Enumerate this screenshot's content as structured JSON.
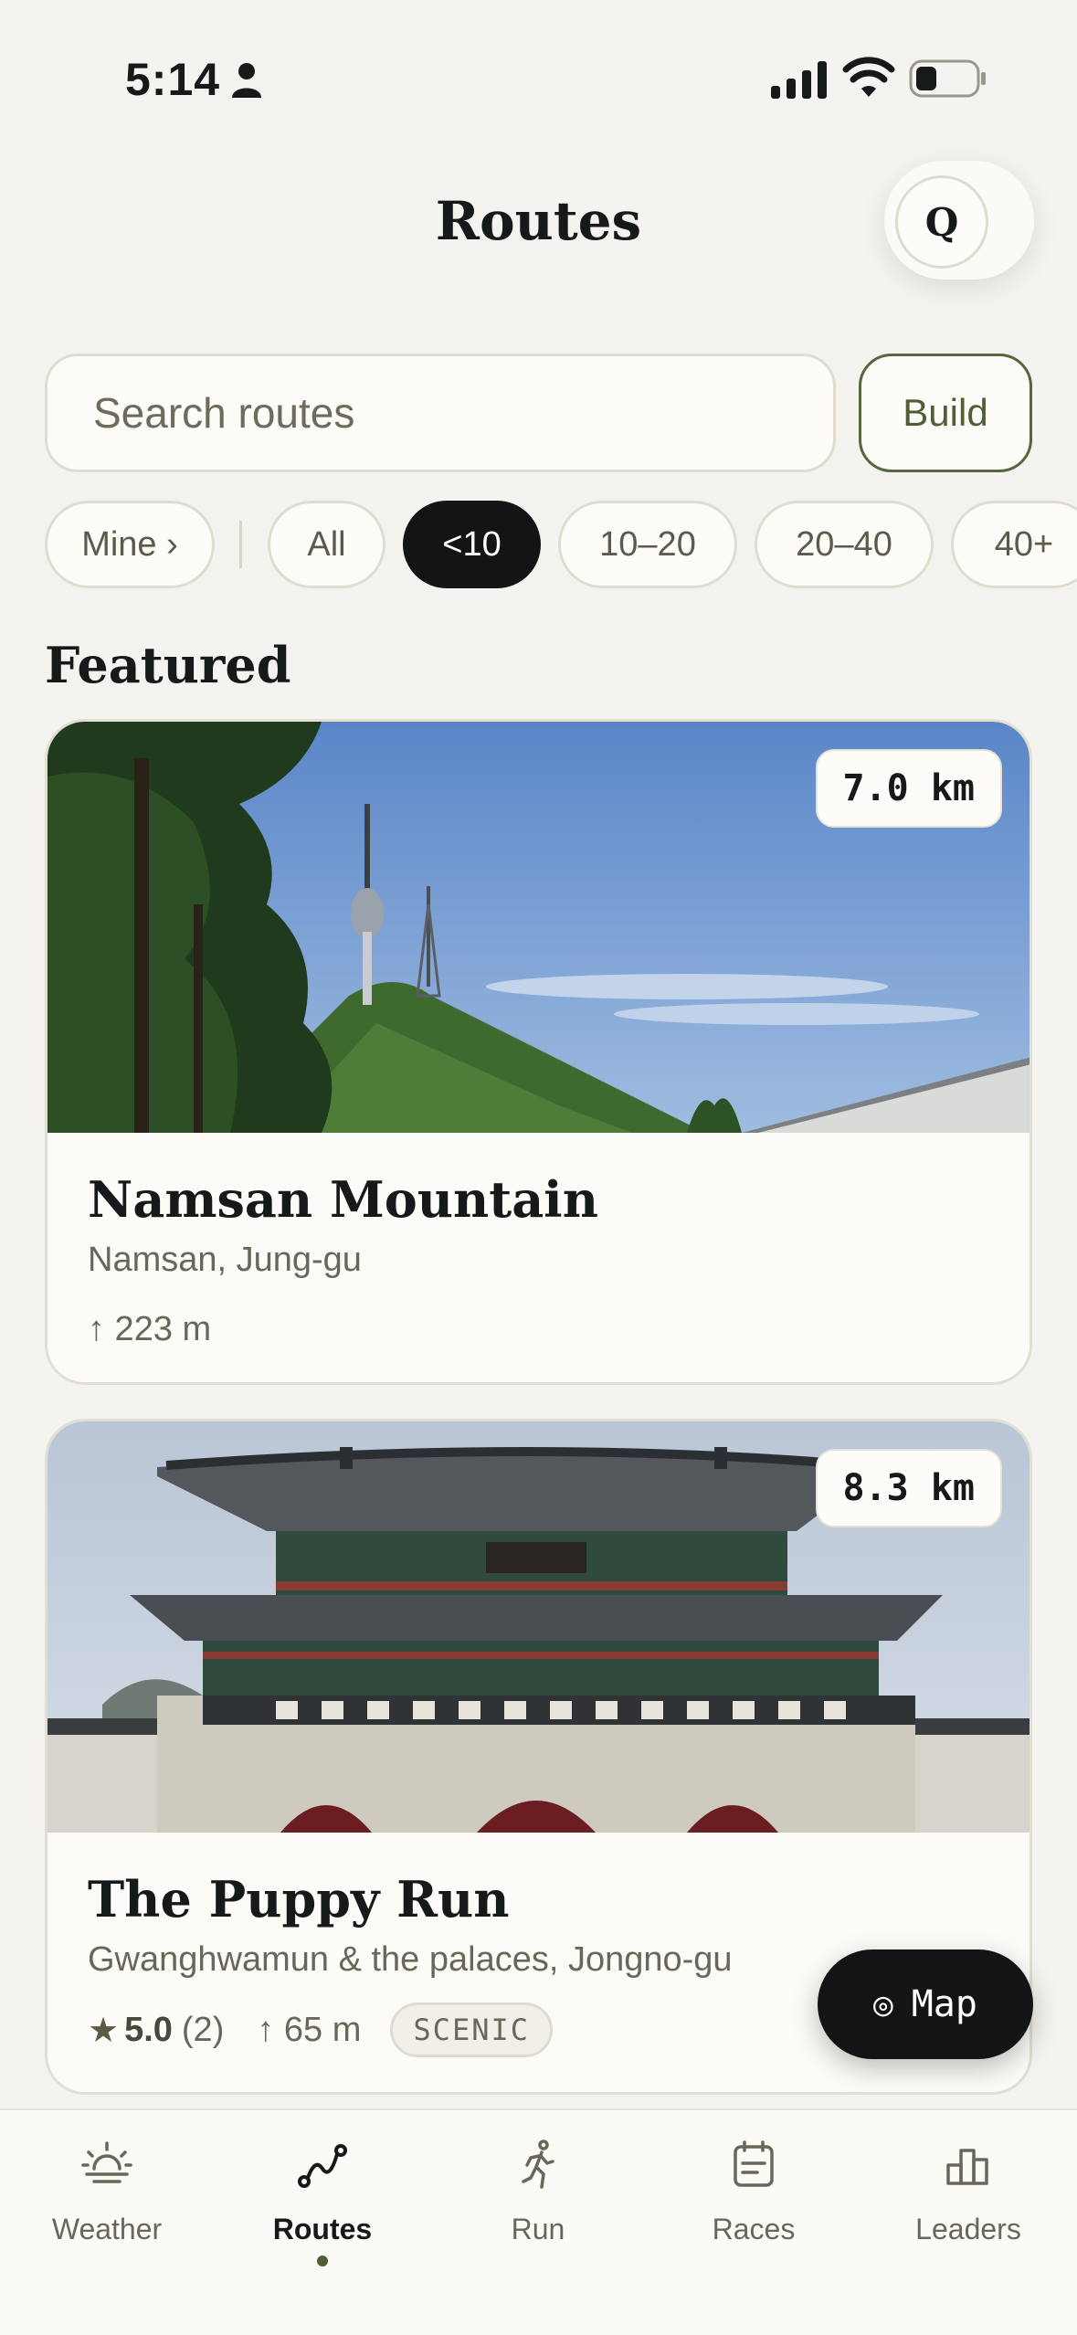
{
  "status": {
    "time": "5:14"
  },
  "header": {
    "title": "Routes",
    "avatar_initial": "Q"
  },
  "search": {
    "placeholder": "Search routes",
    "build_label": "Build"
  },
  "filters": {
    "mine": "Mine ›",
    "chips": [
      "All",
      "<10",
      "10–20",
      "20–40",
      "40+"
    ],
    "active": "<10"
  },
  "section": {
    "featured": "Featured"
  },
  "routes": [
    {
      "title": "Namsan Mountain",
      "location": "Namsan, Jung-gu",
      "distance": "7.0 km",
      "elevation": "↑ 223 m",
      "image": "mountain-tower-photo"
    },
    {
      "title": "The Puppy Run",
      "location": "Gwanghwamun & the palaces, Jongno-gu",
      "distance": "8.3 km",
      "rating_stars": "★",
      "rating": "5.0",
      "rating_count": "(2)",
      "elevation": "↑ 65 m",
      "tag": "SCENIC",
      "image": "palace-gate-photo"
    }
  ],
  "map_button": {
    "icon": "◎",
    "label": "Map"
  },
  "tabs": [
    {
      "label": "Weather",
      "icon": "sun-horizon-icon"
    },
    {
      "label": "Routes",
      "icon": "route-icon",
      "active": true
    },
    {
      "label": "Run",
      "icon": "runner-icon"
    },
    {
      "label": "Races",
      "icon": "calendar-icon"
    },
    {
      "label": "Leaders",
      "icon": "bar-chart-icon"
    }
  ],
  "colors": {
    "accent": "#4f5f35",
    "dark": "#121416",
    "background": "#f4f3ef",
    "card": "#fcfbf7"
  }
}
